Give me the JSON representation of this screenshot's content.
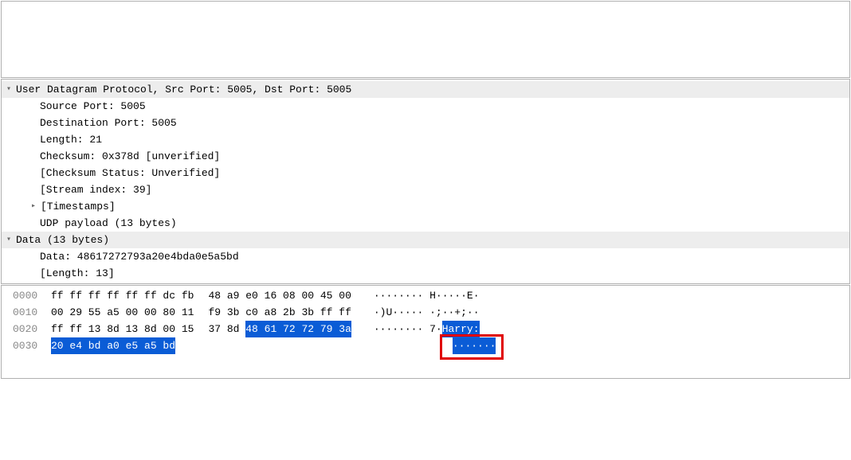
{
  "tree": {
    "udp_header": "User Datagram Protocol, Src Port: 5005, Dst Port: 5005",
    "src_port": "Source Port: 5005",
    "dst_port": "Destination Port: 5005",
    "length": "Length: 21",
    "checksum": "Checksum: 0x378d [unverified]",
    "checksum_status": "[Checksum Status: Unverified]",
    "stream_index": "[Stream index: 39]",
    "timestamps": "[Timestamps]",
    "udp_payload": "UDP payload (13 bytes)",
    "data_header": "Data (13 bytes)",
    "data_value": "Data: 48617272793a20e4bda0e5a5bd",
    "data_length": "[Length: 13]"
  },
  "hex": {
    "rows": [
      {
        "offset": "0000",
        "g1": "ff ff ff ff ff ff dc fb",
        "g2_plain": "48 a9 e0 16 08 00 45 00",
        "g2_hl": "",
        "ascii_plain_a": "········ H·····E·",
        "ascii_hl": "",
        "ascii_plain_b": ""
      },
      {
        "offset": "0010",
        "g1": "00 29 55 a5 00 00 80 11",
        "g2_plain": "f9 3b c0 a8 2b 3b ff ff",
        "g2_hl": "",
        "ascii_plain_a": "·)U····· ·;··+;··",
        "ascii_hl": "",
        "ascii_plain_b": ""
      },
      {
        "offset": "0020",
        "g1": "ff ff 13 8d 13 8d 00 15",
        "g2_plain": "37 8d ",
        "g2_hl": "48 61 72 72 79 3a",
        "ascii_plain_a": "········ 7·",
        "ascii_hl": "Harry:",
        "ascii_plain_b": ""
      },
      {
        "offset": "0030",
        "g1_hl": "20 e4 bd a0 e5 a5 bd",
        "g1_plain": "",
        "g2_plain": "",
        "g2_hl": "",
        "ascii_plain_a": " ",
        "ascii_hl": "·······",
        "ascii_plain_b": ""
      }
    ]
  }
}
